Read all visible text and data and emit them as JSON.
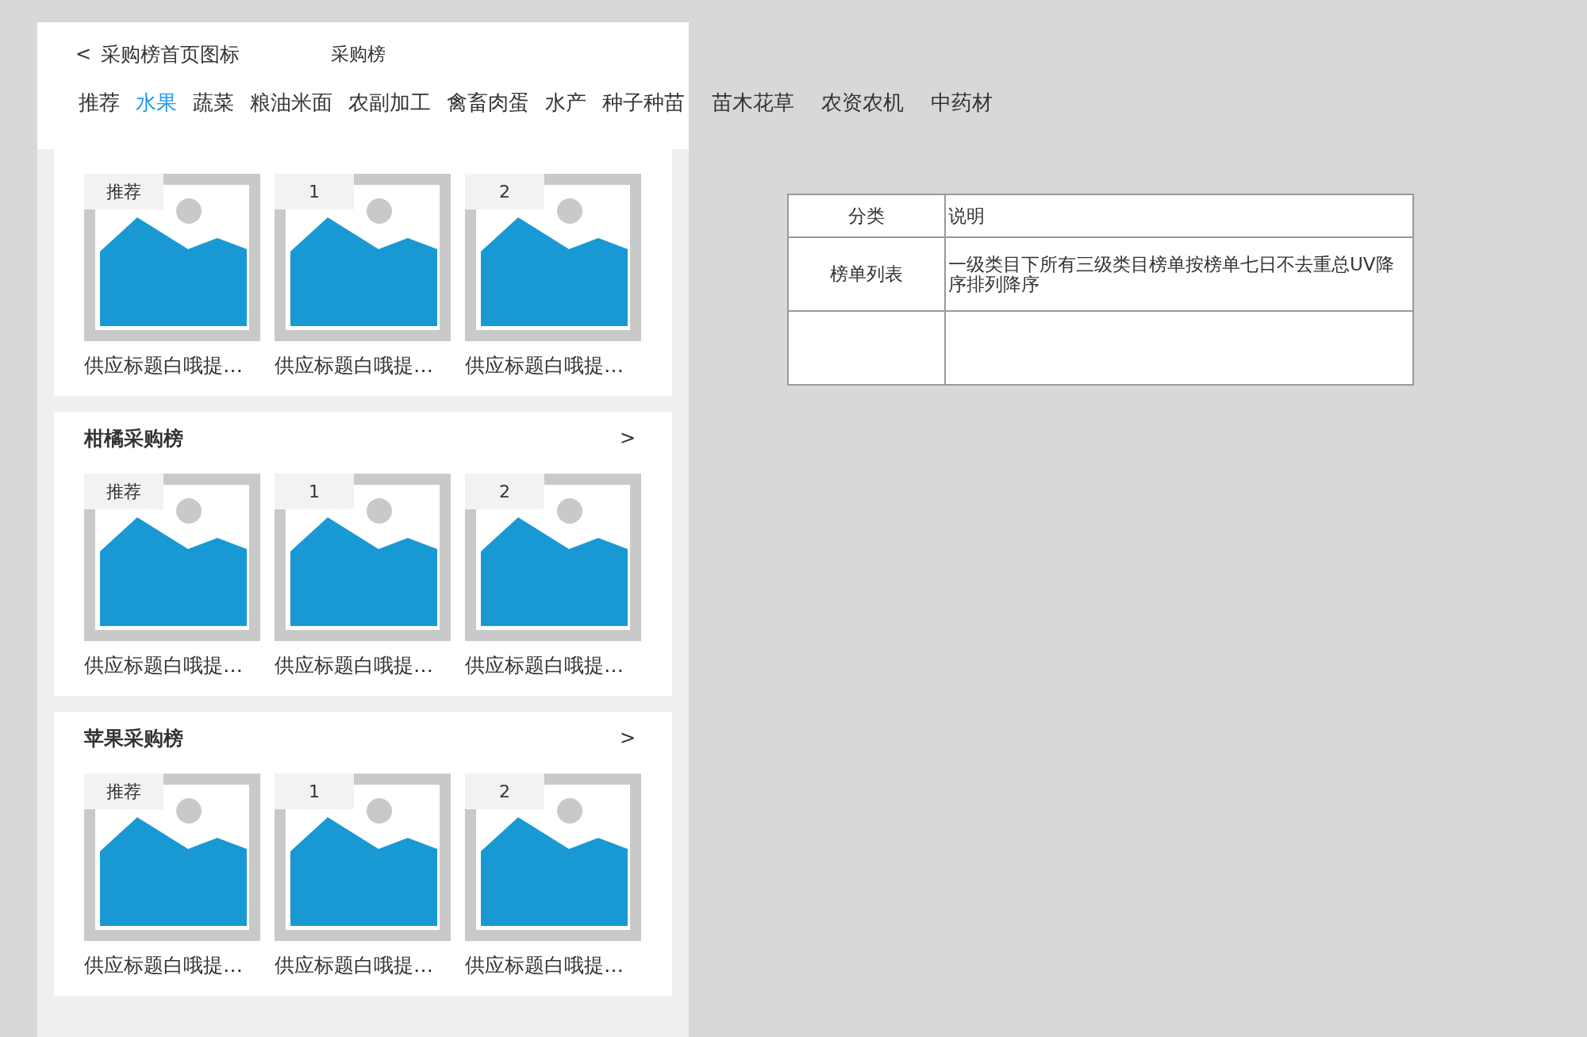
{
  "header": {
    "back": "<",
    "title": "采购榜首页图标",
    "subtitle": "采购榜"
  },
  "tabs": [
    {
      "label": "推荐",
      "selected": false
    },
    {
      "label": "水果",
      "selected": true
    },
    {
      "label": "蔬菜",
      "selected": false
    },
    {
      "label": "粮油米面",
      "selected": false
    },
    {
      "label": "农副加工",
      "selected": false
    },
    {
      "label": "禽畜肉蛋",
      "selected": false
    },
    {
      "label": "水产",
      "selected": false
    },
    {
      "label": "种子种苗",
      "selected": false
    },
    {
      "label": "苗木花草",
      "selected": false
    },
    {
      "label": "农资农机",
      "selected": false
    },
    {
      "label": "中药材",
      "selected": false
    }
  ],
  "sections": [
    {
      "items": [
        {
          "badge": "推荐",
          "caption": "供应标题白哦提…"
        },
        {
          "badge": "1",
          "caption": "供应标题白哦提…"
        },
        {
          "badge": "2",
          "caption": "供应标题白哦提…"
        }
      ]
    },
    {
      "title": "柑橘采购榜",
      "more": ">",
      "items": [
        {
          "badge": "推荐",
          "caption": "供应标题白哦提…"
        },
        {
          "badge": "1",
          "caption": "供应标题白哦提…"
        },
        {
          "badge": "2",
          "caption": "供应标题白哦提…"
        }
      ]
    },
    {
      "title": "苹果采购榜",
      "more": ">",
      "items": [
        {
          "badge": "推荐",
          "caption": "供应标题白哦提…"
        },
        {
          "badge": "1",
          "caption": "供应标题白哦提…"
        },
        {
          "badge": "2",
          "caption": "供应标题白哦提…"
        }
      ]
    }
  ],
  "table": {
    "columns": [
      "分类",
      "说明"
    ],
    "rows": [
      {
        "category": "榜单列表",
        "description": "一级类目下所有三级类目榜单按榜单七日不去重总UV降序排列降序"
      },
      {}
    ]
  }
}
